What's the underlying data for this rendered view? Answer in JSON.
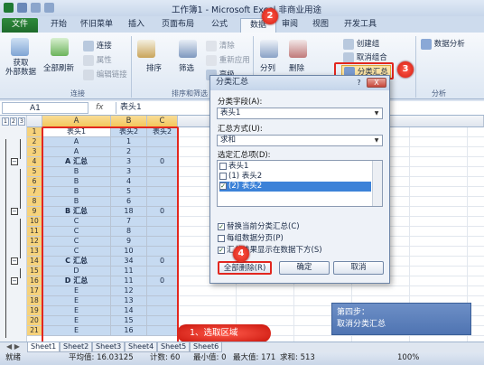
{
  "window": {
    "title": "工作簿1 - Microsoft Excel 非商业用途"
  },
  "tabs": [
    "文件",
    "开始",
    "怀旧菜单",
    "插入",
    "页面布局",
    "公式",
    "数据",
    "审阅",
    "视图",
    "开发工具"
  ],
  "ribbon": {
    "get_external": "获取\n外部数据",
    "refresh_all": "全部刷新",
    "connections": "连接",
    "properties": "属性",
    "edit_links": "编辑链接",
    "group_connections": "连接",
    "sort": "排序",
    "filter": "筛选",
    "clear": "清除",
    "reapply": "重新应用",
    "advanced": "高级",
    "group_sort_filter": "排序和筛选",
    "text_to_columns": "分列",
    "remove_dup": "删除",
    "create_group": "创建组",
    "ungroup": "取消组合",
    "subtotal": "分类汇总",
    "data_analysis": "数据分析",
    "group_analysis": "分析"
  },
  "formula_bar": {
    "namebox": "A1",
    "fx": "fx",
    "value": "表头1"
  },
  "outline_levels": [
    "1",
    "2",
    "3"
  ],
  "columns": [
    "A",
    "B",
    "C"
  ],
  "rows": [
    {
      "n": "1",
      "a": "表头1",
      "b": "表头2",
      "c": "表头2",
      "kind": "header"
    },
    {
      "n": "2",
      "a": "A",
      "b": "1",
      "c": "",
      "kind": "data"
    },
    {
      "n": "3",
      "a": "A",
      "b": "2",
      "c": "",
      "kind": "data"
    },
    {
      "n": "4",
      "a": "A 汇总",
      "b": "3",
      "c": "0",
      "kind": "total"
    },
    {
      "n": "5",
      "a": "B",
      "b": "3",
      "c": "",
      "kind": "data"
    },
    {
      "n": "6",
      "a": "B",
      "b": "4",
      "c": "",
      "kind": "data"
    },
    {
      "n": "7",
      "a": "B",
      "b": "5",
      "c": "",
      "kind": "data"
    },
    {
      "n": "8",
      "a": "B",
      "b": "6",
      "c": "",
      "kind": "data"
    },
    {
      "n": "9",
      "a": "B 汇总",
      "b": "18",
      "c": "0",
      "kind": "total"
    },
    {
      "n": "10",
      "a": "C",
      "b": "7",
      "c": "",
      "kind": "data"
    },
    {
      "n": "11",
      "a": "C",
      "b": "8",
      "c": "",
      "kind": "data"
    },
    {
      "n": "12",
      "a": "C",
      "b": "9",
      "c": "",
      "kind": "data"
    },
    {
      "n": "13",
      "a": "C",
      "b": "10",
      "c": "",
      "kind": "data"
    },
    {
      "n": "14",
      "a": "C 汇总",
      "b": "34",
      "c": "0",
      "kind": "total"
    },
    {
      "n": "15",
      "a": "D",
      "b": "11",
      "c": "",
      "kind": "data"
    },
    {
      "n": "16",
      "a": "D 汇总",
      "b": "11",
      "c": "0",
      "kind": "total"
    },
    {
      "n": "17",
      "a": "E",
      "b": "12",
      "c": "",
      "kind": "data"
    },
    {
      "n": "18",
      "a": "E",
      "b": "13",
      "c": "",
      "kind": "data"
    },
    {
      "n": "19",
      "a": "E",
      "b": "14",
      "c": "",
      "kind": "data"
    },
    {
      "n": "20",
      "a": "E",
      "b": "15",
      "c": "",
      "kind": "data"
    },
    {
      "n": "21",
      "a": "E",
      "b": "16",
      "c": "",
      "kind": "data"
    }
  ],
  "dialog": {
    "title": "分类汇总",
    "help": "?",
    "close": "X",
    "field_label": "分类字段(A):",
    "field_value": "表头1",
    "func_label": "汇总方式(U):",
    "func_value": "求和",
    "items_label": "选定汇总项(D):",
    "items": [
      {
        "label": "表头1",
        "checked": false,
        "selected": false
      },
      {
        "label": "(1) 表头2",
        "checked": false,
        "selected": false
      },
      {
        "label": "(2) 表头2",
        "checked": true,
        "selected": true
      }
    ],
    "opt_replace": "替换当前分类汇总(C)",
    "opt_pagebreak": "每组数据分页(P)",
    "opt_below": "汇总结果显示在数据下方(S)",
    "btn_remove_all": "全部删除(R)",
    "btn_ok": "确定",
    "btn_cancel": "取消"
  },
  "annotations": {
    "step2": "2",
    "step3": "3",
    "step4": "4",
    "callout_select": "1、选取区域",
    "info_line1": "第四步：",
    "info_line2": "取消分类汇总"
  },
  "sheets": [
    "Sheet1",
    "Sheet2",
    "Sheet3",
    "Sheet4",
    "Sheet5",
    "Sheet6"
  ],
  "status": {
    "ready": "就绪",
    "average": "平均值: 16.03125",
    "count": "计数: 60",
    "min": "最小值: 0",
    "max": "最大值: 171",
    "sum": "求和: 513",
    "zoom": "100%"
  },
  "colors": {
    "accent_red": "#e2271f",
    "selection_blue": "#c6daf1",
    "file_tab": "#2f8a3c"
  }
}
